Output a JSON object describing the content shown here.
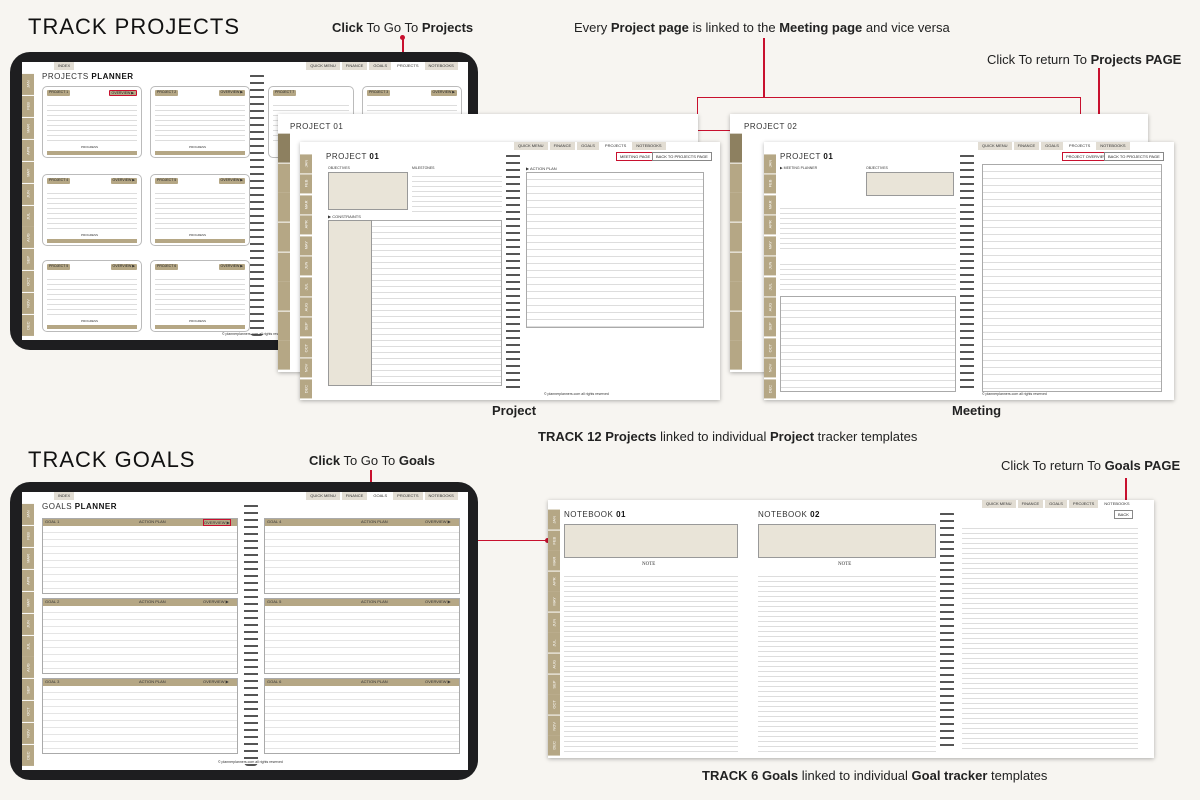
{
  "projects": {
    "heading": "TRACK PROJECTS",
    "click_note": {
      "bold1": "Click",
      "mid": " To Go To ",
      "bold2": "Projects"
    },
    "linked_note": {
      "pre": "Every ",
      "b1": "Project page",
      "mid": " is linked to the ",
      "b2": "Meeting page",
      "post": " and vice versa"
    },
    "return_note": {
      "pre": "Click To return To  ",
      "b": "Projects PAGE"
    },
    "planner_title": {
      "light": "PROJECTS ",
      "bold": "PLANNER"
    },
    "cards": [
      "PROJECT 1",
      "PROJECT 2",
      "PROJECT 3",
      "PROJECT 4",
      "PROJECT 5",
      "PROJECT 6",
      "PROJECT 7",
      "PROJECT 8"
    ],
    "overview_label": "OVERVIEW ▶",
    "card_fields": [
      "TITLE :",
      "START DATE :",
      "DUE DATE :",
      "COMPLETED DATE :"
    ],
    "progress_label": "PROGRESS",
    "project_page": {
      "title_light": "PROJECT ",
      "title_bold": "01",
      "back_title": "PROJECT 01",
      "objectives": "OBJECTIVES",
      "milestones": "MILESTONES",
      "constraints": "▶ CONSTRAINTS",
      "constraint_rows": [
        "TIME",
        "BUDGET",
        "SCOPE",
        "QUALITY REQUIREMENTS",
        "LEGAL OR REGULATORY REQUIREMENTS",
        "RISK CONSTRAINTS",
        "RESOURCES REQUIRED"
      ],
      "action_plan": "▶ ACTION PLAN",
      "cols": [
        "ACTION PLAN",
        "DUE DATE",
        "COMPLETED ON"
      ],
      "meeting_btn": "MEETING PAGE",
      "back_btn": "BACK TO PROJECTS PAGE",
      "caption": "Project"
    },
    "meeting_page": {
      "title_light": "PROJECT ",
      "title_bold": "01",
      "back_title": "PROJECT 02",
      "meeting_planner": "▶ MEETING PLANNER",
      "objectives": "OBJECTIVES",
      "fields": [
        "TITLE",
        "DATE",
        "TIME",
        "LOCATION",
        "COMPLETED ON"
      ],
      "attendees": "ATTENDEES",
      "absentees": "ABSENTEES",
      "agenda": "AGENDA",
      "cols": [
        "ACTIONS",
        "WHO",
        "DEADLINE"
      ],
      "overview_btn": "PROJECT OVERVIEW",
      "back_btn": "BACK TO PROJECTS PAGE",
      "caption": "Meeting"
    },
    "bottom_caption": {
      "pre": "TRACK 12 ",
      "b1": "Projects",
      "mid": " linked to individual ",
      "b2": "Project",
      "post": " tracker templates"
    }
  },
  "goals": {
    "heading": "TRACK GOALS",
    "click_note": {
      "bold1": "Click",
      "mid": " To Go To ",
      "bold2": "Goals"
    },
    "return_note": {
      "pre": "Click To return To  ",
      "b": "Goals PAGE"
    },
    "planner_title": {
      "light": "GOALS ",
      "bold": "PLANNER"
    },
    "cards": [
      "GOAL 1",
      "GOAL 4",
      "GOAL 2",
      "GOAL 5",
      "GOAL 3",
      "GOAL 6"
    ],
    "action_plan": "ACTION PLAN",
    "overview_label": "OVERVIEW ▶",
    "fields": [
      "START DATE :",
      "DEADLINE :"
    ],
    "progress_label": "PROGRESS",
    "notebook1": {
      "light": "NOTEBOOK ",
      "bold": "01"
    },
    "notebook2": {
      "light": "NOTEBOOK ",
      "bold": "02"
    },
    "note_label": "NOTE",
    "back_btn": "BACK",
    "bottom_caption": {
      "pre": "TRACK 6 ",
      "b1": "Goals",
      "mid": " linked to individual ",
      "b2": "Goal tracker",
      "post": " templates"
    }
  },
  "nav_tabs": [
    "INDEX",
    "QUICK MENU",
    "FINANCE",
    "GOALS",
    "PROJECTS",
    "NOTEBOOKS"
  ],
  "months": [
    "JAN",
    "FEB",
    "MAR",
    "APR",
    "MAY",
    "JUN",
    "JUL",
    "AUG",
    "SEP",
    "OCT",
    "NOV",
    "DEC"
  ],
  "footer": "© plannerplanners.com  all rights reserved",
  "accent_color": "#c8102e",
  "gold_color": "#b5a785"
}
